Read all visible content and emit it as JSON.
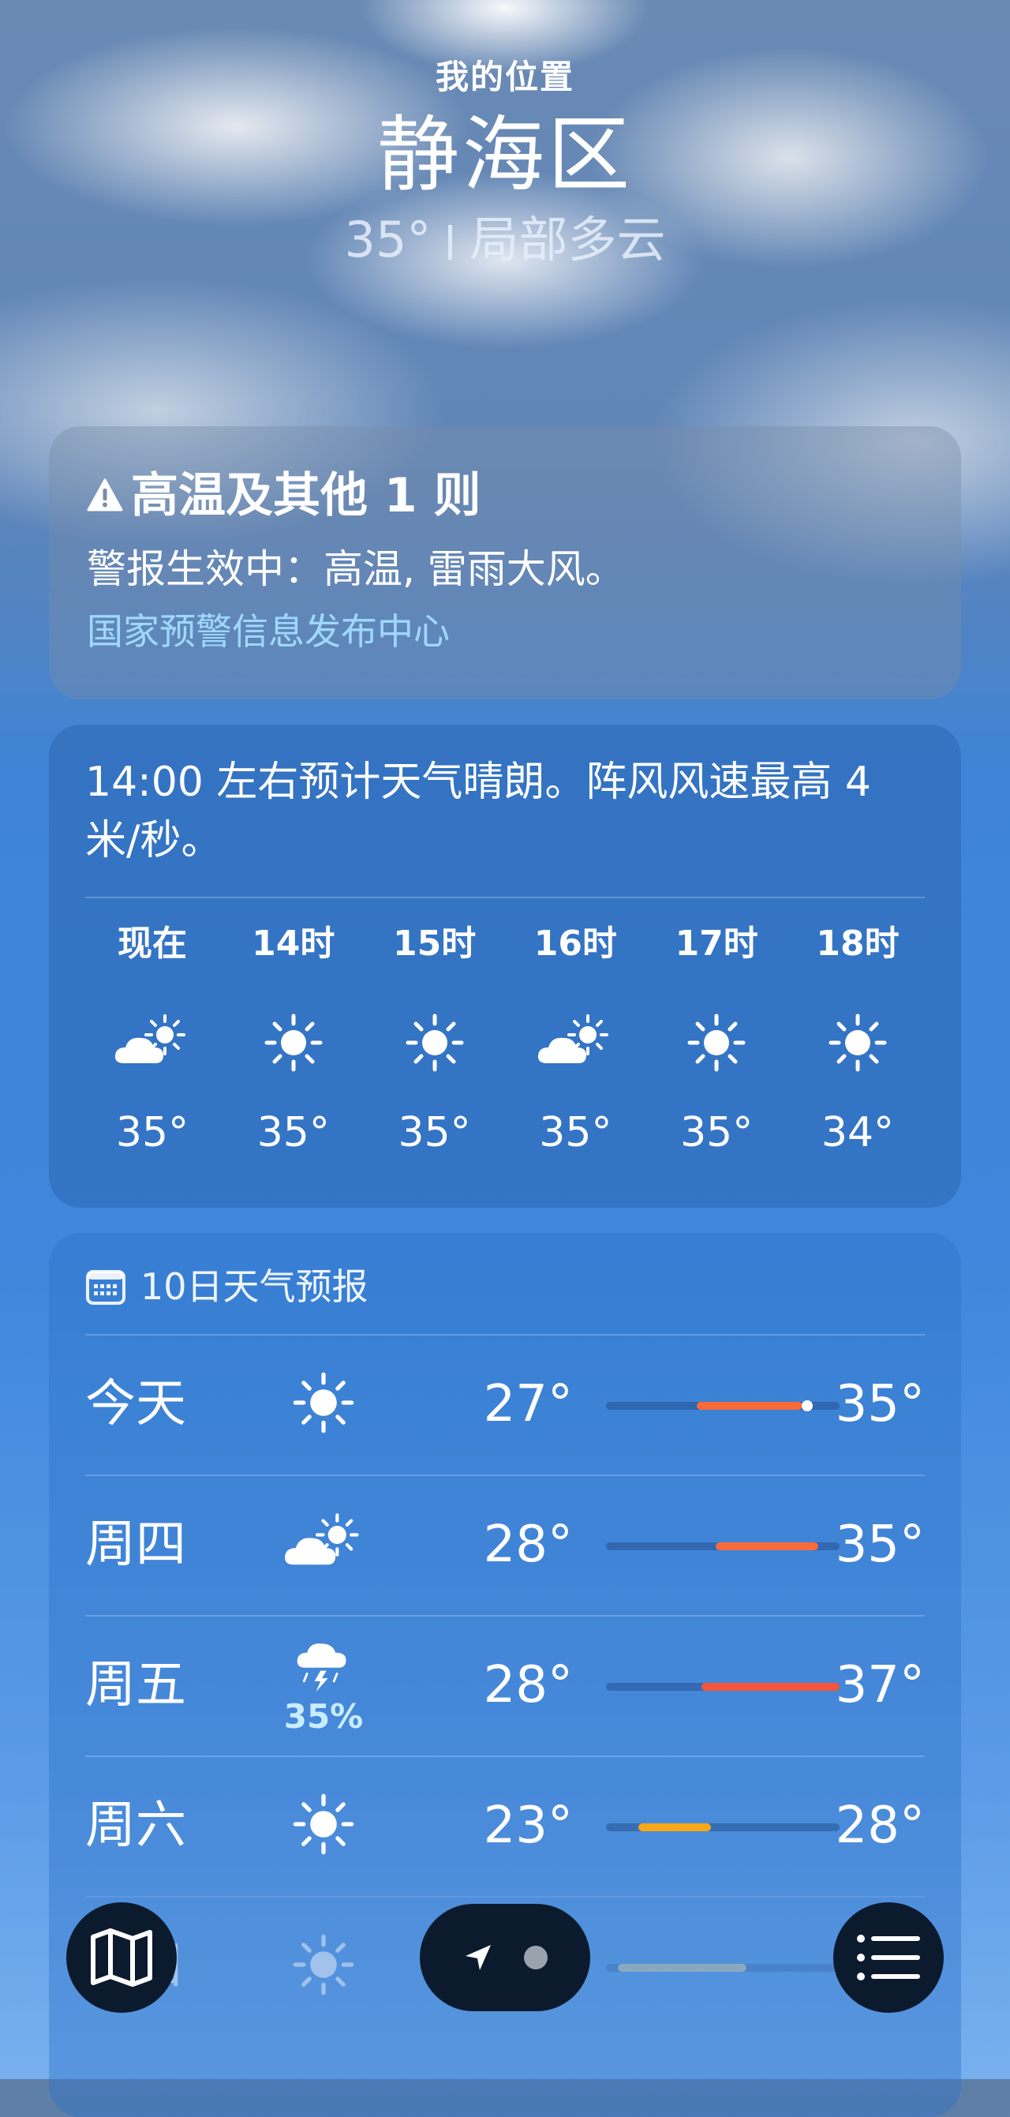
{
  "header": {
    "location_label": "我的位置",
    "city": "静海区",
    "temp": "35°",
    "condition": "局部多云"
  },
  "alert": {
    "icon": "warning-triangle-icon",
    "title": "高温及其他 1 则",
    "body": "警报生效中：高温, 雷雨大风。",
    "source": "国家预警信息发布中心"
  },
  "hourly": {
    "summary": "14:00 左右预计天气晴朗。阵风风速最高 4 米/秒。",
    "hours": [
      {
        "label": "现在",
        "icon": "partly-cloudy-icon",
        "temp": "35°"
      },
      {
        "label": "14时",
        "icon": "sun-icon",
        "temp": "35°"
      },
      {
        "label": "15时",
        "icon": "sun-icon",
        "temp": "35°"
      },
      {
        "label": "16时",
        "icon": "partly-cloudy-icon",
        "temp": "35°"
      },
      {
        "label": "17时",
        "icon": "sun-icon",
        "temp": "35°"
      },
      {
        "label": "18时",
        "icon": "sun-icon",
        "temp": "34°"
      }
    ]
  },
  "daily": {
    "title": "10日天气预报",
    "icon": "calendar-icon",
    "days": [
      {
        "day": "今天",
        "icon": "sun-icon",
        "precip": "",
        "low": "27°",
        "high": "35°",
        "range_start": 0.39,
        "range_end": 0.84,
        "current_dot": 0.86,
        "color": "#f76a3a"
      },
      {
        "day": "周四",
        "icon": "partly-cloudy-icon",
        "precip": "",
        "low": "28°",
        "high": "35°",
        "range_start": 0.47,
        "range_end": 0.91,
        "current_dot": null,
        "color": "#f76a3a"
      },
      {
        "day": "周五",
        "icon": "thunderstorm-icon",
        "precip": "35%",
        "low": "28°",
        "high": "37°",
        "range_start": 0.41,
        "range_end": 1.0,
        "current_dot": null,
        "color": "#f5553a"
      },
      {
        "day": "周六",
        "icon": "sun-icon",
        "precip": "",
        "low": "23°",
        "high": "28°",
        "range_start": 0.14,
        "range_end": 0.45,
        "current_dot": null,
        "color": "#f7a91a"
      },
      {
        "day": "周日",
        "icon": "sun-icon",
        "precip": "",
        "low": "",
        "high": "",
        "range_start": 0.05,
        "range_end": 0.6,
        "current_dot": null,
        "color": "#c8c8a0"
      }
    ]
  },
  "nav": {
    "map_button": "map-icon",
    "location_button": "location-arrow-icon",
    "list_button": "list-icon"
  }
}
